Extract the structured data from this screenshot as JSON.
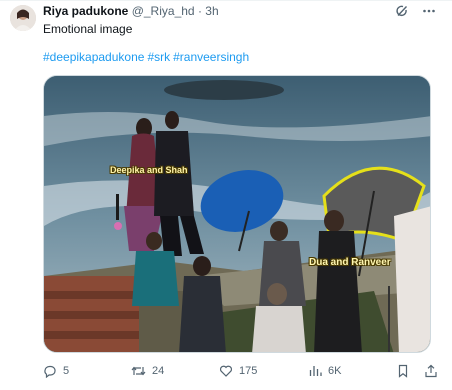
{
  "tweet": {
    "display_name": "Riya padukone",
    "handle": "@_Riya_hd",
    "separator": "·",
    "time": "3h",
    "text": "Emotional image",
    "hashtags": [
      "#deepikapadukone",
      "#srk",
      "#ranveersingh"
    ]
  },
  "media": {
    "overlay_labels": {
      "left": "Deepika and Shah",
      "right": "Dua and Ranveer"
    }
  },
  "actions": {
    "replies": "5",
    "retweets": "24",
    "likes": "175",
    "views": "6K"
  },
  "icons": {
    "avatar": "avatar",
    "top": [
      "grok-icon",
      "more-icon"
    ],
    "actions": [
      "reply-icon",
      "retweet-icon",
      "like-icon",
      "views-icon",
      "bookmark-icon",
      "share-icon"
    ]
  },
  "colors": {
    "link": "#1d9bf0",
    "muted": "#536471",
    "text": "#0f1419"
  }
}
